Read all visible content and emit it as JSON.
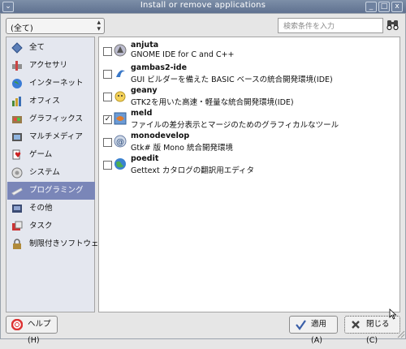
{
  "window": {
    "title": "Install or remove applications",
    "menu_glyph": "⌄",
    "min_glyph": "_",
    "max_glyph": "□",
    "close_glyph": "x"
  },
  "filter": {
    "selected": "(全て)"
  },
  "search": {
    "placeholder": "検索条件を入力"
  },
  "sidebar": {
    "items": [
      {
        "label": "全て",
        "icon": "all-icon"
      },
      {
        "label": "アクセサリ",
        "icon": "accessories-icon"
      },
      {
        "label": "インターネット",
        "icon": "internet-icon"
      },
      {
        "label": "オフィス",
        "icon": "office-icon"
      },
      {
        "label": "グラフィックス",
        "icon": "graphics-icon"
      },
      {
        "label": "マルチメディア",
        "icon": "multimedia-icon"
      },
      {
        "label": "ゲーム",
        "icon": "games-icon"
      },
      {
        "label": "システム",
        "icon": "system-icon"
      },
      {
        "label": "プログラミング",
        "icon": "programming-icon",
        "selected": true
      },
      {
        "label": "その他",
        "icon": "other-icon"
      },
      {
        "label": "タスク",
        "icon": "tasks-icon"
      },
      {
        "label": "制限付きソフトウェア",
        "icon": "restricted-software-icon"
      }
    ]
  },
  "packages": [
    {
      "name": "anjuta",
      "description": "GNOME IDE for C and C++",
      "checked": false,
      "icon": "anjuta-icon"
    },
    {
      "name": "gambas2-ide",
      "description": "GUI ビルダーを備えた BASIC ベースの統合開発環境(IDE)",
      "checked": false,
      "icon": "gambas-icon"
    },
    {
      "name": "geany",
      "description": "GTK2を用いた高速・軽量な統合開発環境(IDE)",
      "checked": false,
      "icon": "geany-icon"
    },
    {
      "name": "meld",
      "description": "ファイルの差分表示とマージのためのグラフィカルなツール",
      "checked": true,
      "icon": "meld-icon"
    },
    {
      "name": "monodevelop",
      "description": "Gtk# 版 Mono 統合開発環境",
      "checked": false,
      "icon": "monodevelop-icon"
    },
    {
      "name": "poedit",
      "description": "Gettext カタログの翻訳用エディタ",
      "checked": false,
      "icon": "poedit-icon"
    }
  ],
  "buttons": {
    "help": "ヘルプ(H)",
    "apply": "適用(A)",
    "close": "閉じる(C)"
  },
  "colors": {
    "selection": "#7a86b8",
    "titlebar": "#6a7c99"
  }
}
